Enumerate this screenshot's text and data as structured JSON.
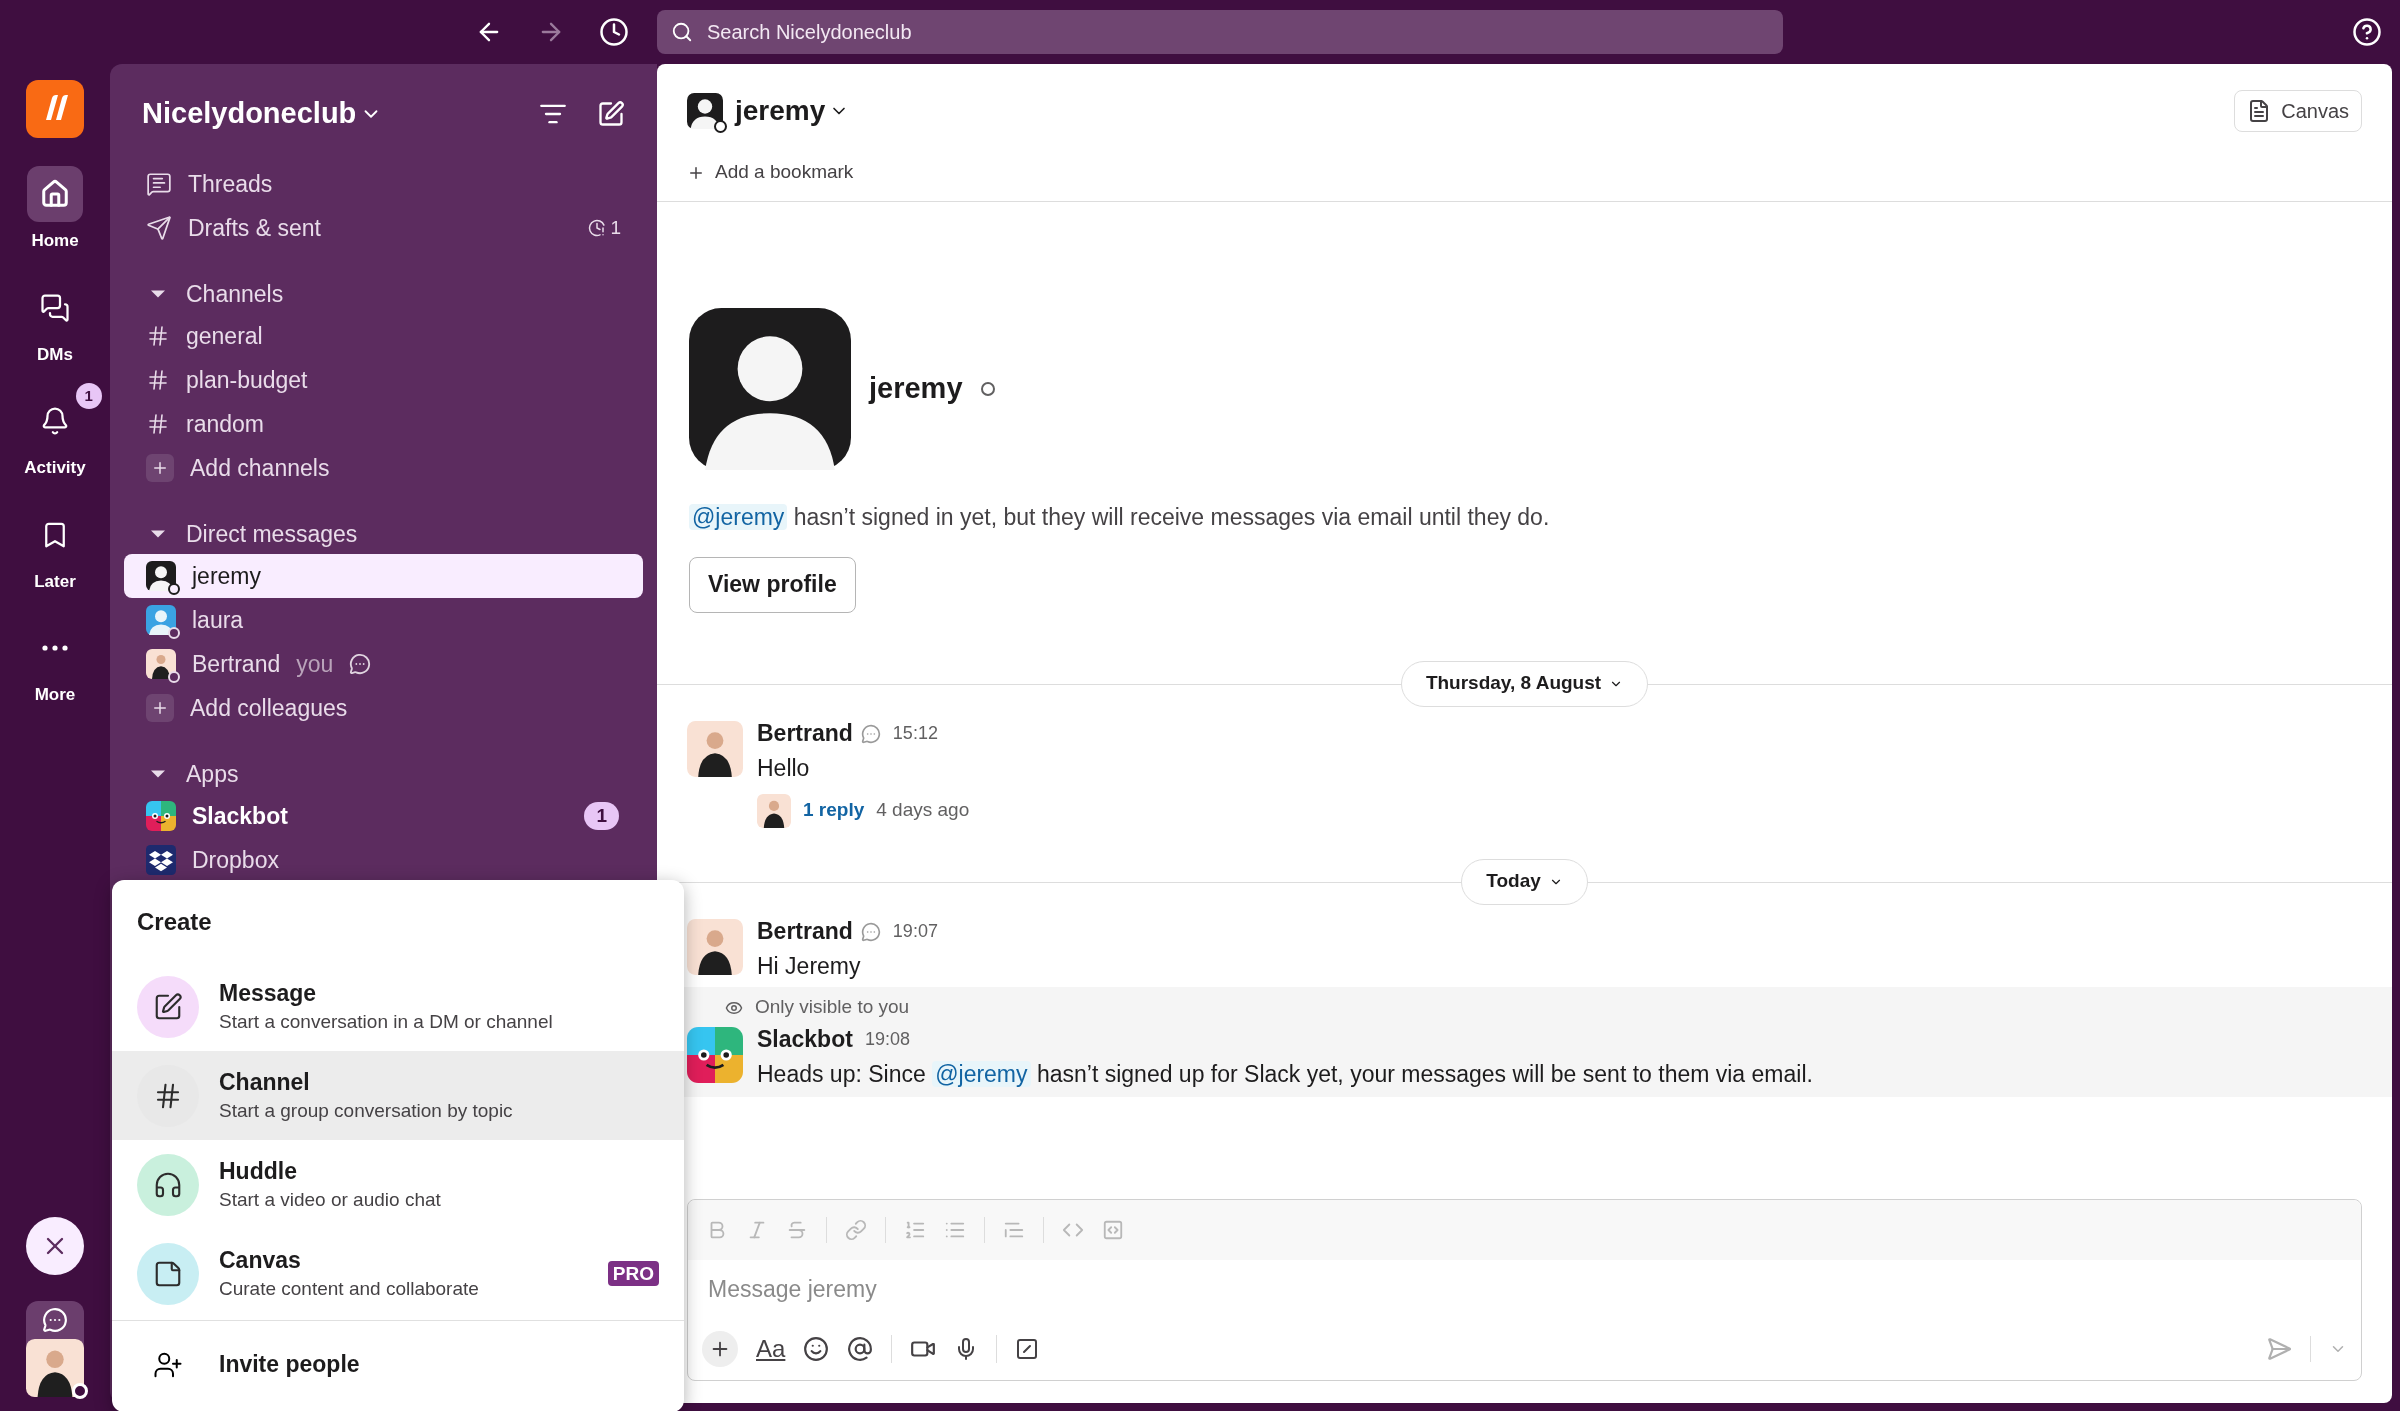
{
  "topbar": {
    "search_placeholder": "Search Nicelydoneclub"
  },
  "rail": [
    {
      "label": "Home",
      "selected": true
    },
    {
      "label": "DMs",
      "selected": false
    },
    {
      "label": "Activity",
      "selected": false,
      "badge": "1"
    },
    {
      "label": "Later",
      "selected": false
    },
    {
      "label": "More",
      "selected": false
    }
  ],
  "sidebar": {
    "workspace": "Nicelydoneclub",
    "top_items": [
      {
        "label": "Threads"
      },
      {
        "label": "Drafts & sent",
        "count": "1"
      }
    ],
    "sections": [
      {
        "title": "Channels",
        "expanded": true,
        "items": [
          {
            "kind": "channel",
            "label": "general",
            "selected": false,
            "unread": false
          },
          {
            "kind": "channel",
            "label": "plan-budget",
            "selected": false,
            "unread": false
          },
          {
            "kind": "channel",
            "label": "random",
            "selected": false,
            "unread": false
          },
          {
            "kind": "add",
            "label": "Add channels",
            "selected": false,
            "unread": false
          }
        ]
      },
      {
        "title": "Direct messages",
        "expanded": true,
        "items": [
          {
            "kind": "dm",
            "label": "jeremy",
            "selected": true,
            "unread": false
          },
          {
            "kind": "dm",
            "label": "laura",
            "selected": false,
            "unread": false
          },
          {
            "kind": "dm",
            "label": "Bertrand",
            "suffix": "you",
            "status": true,
            "selected": false,
            "unread": false
          },
          {
            "kind": "add",
            "label": "Add colleagues",
            "selected": false,
            "unread": false
          }
        ]
      },
      {
        "title": "Apps",
        "expanded": true,
        "items": [
          {
            "kind": "app",
            "label": "Slackbot",
            "badge": "1",
            "selected": false,
            "unread": true
          },
          {
            "kind": "app",
            "label": "Dropbox",
            "selected": false,
            "unread": false
          }
        ]
      }
    ]
  },
  "header": {
    "name": "jeremy",
    "bookmark": "Add a bookmark",
    "canvas_button": "Canvas"
  },
  "intro": {
    "name": "jeremy",
    "mention": "@jeremy",
    "notice": " hasn’t signed in yet, but they will receive messages via email until they do.",
    "button": "View profile"
  },
  "days": [
    {
      "label": "Thursday, 8 August",
      "messages": [
        {
          "kind": "user",
          "author": "Bertrand",
          "time": "15:12",
          "text": "Hello",
          "thread": {
            "replies": "1 reply",
            "when": "4 days ago"
          }
        }
      ]
    },
    {
      "label": "Today",
      "messages": [
        {
          "kind": "user",
          "author": "Bertrand",
          "time": "19:07",
          "text": "Hi Jeremy"
        },
        {
          "kind": "bot",
          "author": "Slackbot",
          "time": "19:08",
          "note": "Only visible to you",
          "segments": [
            {
              "kind": "text",
              "text": "Heads up: Since "
            },
            {
              "kind": "mention",
              "text": "@jeremy"
            },
            {
              "kind": "text",
              "text": " hasn’t signed up for Slack yet, your messages will be sent to them via email."
            }
          ]
        }
      ]
    }
  ],
  "composer": {
    "placeholder": "Message jeremy",
    "format_button": "Aa"
  },
  "create_menu": {
    "title": "Create",
    "items": [
      {
        "label": "Message",
        "description": "Start a conversation in a DM or channel",
        "color": "#f5dcfa",
        "selected": false
      },
      {
        "label": "Channel",
        "description": "Start a group conversation by topic",
        "color": "#e8e8e8",
        "selected": true
      },
      {
        "label": "Huddle",
        "description": "Start a video or audio chat",
        "color": "#c9f0dd",
        "selected": false
      },
      {
        "label": "Canvas",
        "description": "Curate content and collaborate",
        "color": "#c8eef3",
        "selected": false,
        "badge": "PRO"
      }
    ],
    "footer": "Invite people"
  }
}
